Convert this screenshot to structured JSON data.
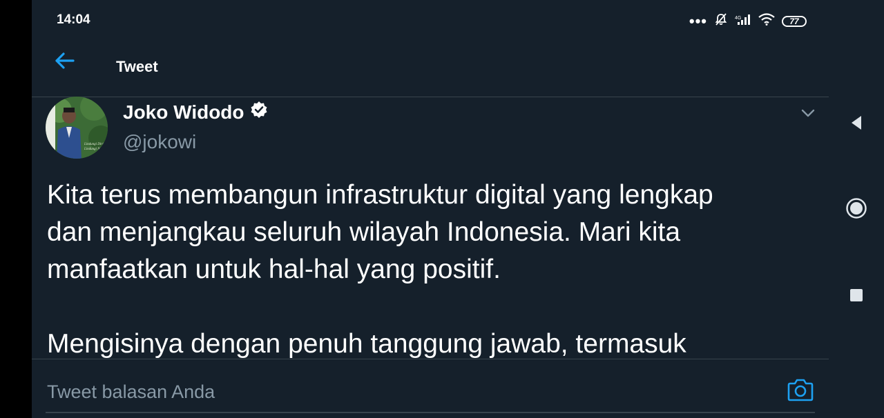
{
  "status_bar": {
    "time": "14:04",
    "dots": "•••",
    "battery": "77",
    "icons": [
      "bell-muted-icon",
      "signal-icon",
      "wifi-icon",
      "battery-icon"
    ]
  },
  "header": {
    "title": "Tweet",
    "back_icon": "arrow-left-icon"
  },
  "tweet": {
    "author_name": "Joko Widodo",
    "verified_icon": "verified-badge-icon",
    "author_handle": "@jokowi",
    "text": "Kita terus membangun infrastruktur digital yang lengkap\ndan menjangkau seluruh wilayah Indonesia. Mari kita\nmanfaatkan untuk hal-hal yang positif.\n\nMengisinya dengan penuh tanggung jawab, termasuk"
  },
  "reply": {
    "placeholder": "Tweet balasan Anda",
    "camera_icon": "camera-icon"
  },
  "nav": {
    "icons": [
      "nav-back-icon",
      "nav-home-icon",
      "nav-recents-icon"
    ]
  },
  "colors": {
    "background": "#15202b",
    "accent": "#1da1f2",
    "secondary_text": "#8899a6",
    "divider": "#38444d"
  }
}
